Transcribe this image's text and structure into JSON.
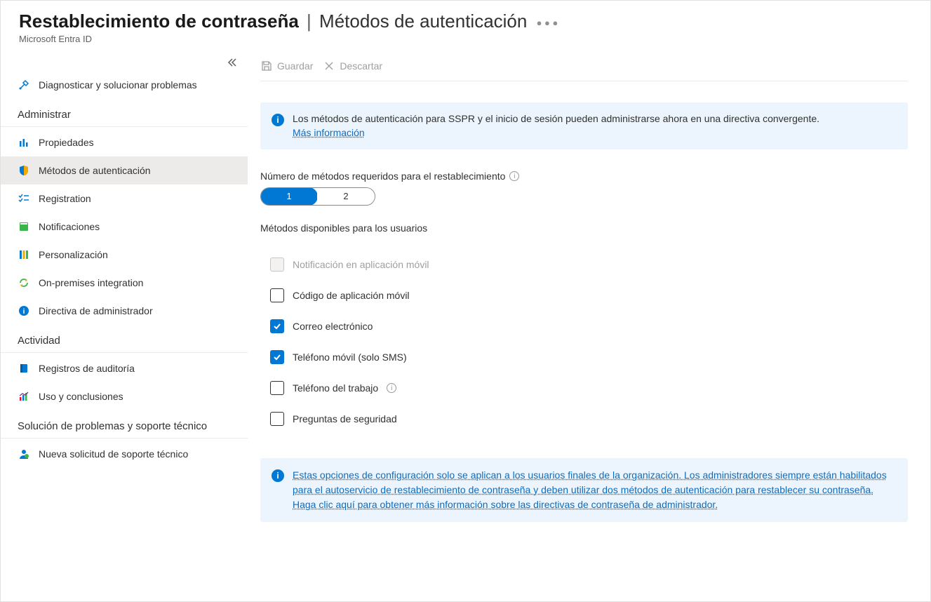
{
  "header": {
    "title_main": "Restablecimiento de contraseña",
    "title_sub": "Métodos de autenticación",
    "subtitle": "Microsoft Entra ID"
  },
  "toolbar": {
    "save_label": "Guardar",
    "discard_label": "Descartar"
  },
  "sidebar": {
    "diagnose": "Diagnosticar y solucionar problemas",
    "section_manage": "Administrar",
    "properties": "Propiedades",
    "auth_methods": "Métodos de autenticación",
    "registration": "Registration",
    "notifications": "Notificaciones",
    "personalization": "Personalización",
    "onprem": "On-premises integration",
    "admin_policy": "Directiva de administrador",
    "section_activity": "Actividad",
    "audit_logs": "Registros de auditoría",
    "usage": "Uso y conclusiones",
    "section_support": "Solución de problemas y soporte técnico",
    "new_request": "Nueva solicitud de soporte técnico"
  },
  "info_banner": {
    "text": "Los métodos de autenticación para SSPR y el inicio de sesión pueden administrarse ahora en una directiva convergente.",
    "link": "Más información"
  },
  "methods_required": {
    "label": "Número de métodos requeridos para el restablecimiento",
    "option1": "1",
    "option2": "2",
    "selected": "1"
  },
  "available_methods": {
    "label": "Métodos disponibles para los usuarios",
    "items": {
      "mobile_app_notification": "Notificación en aplicación móvil",
      "mobile_app_code": "Código de aplicación móvil",
      "email": "Correo electrónico",
      "mobile_phone_sms": "Teléfono móvil (solo SMS)",
      "office_phone": "Teléfono del trabajo",
      "security_questions": "Preguntas de seguridad"
    }
  },
  "bottom_notice": "Estas opciones de configuración solo se aplican a los usuarios finales de la organización. Los administradores siempre están habilitados para el autoservicio de restablecimiento de contraseña y deben utilizar dos métodos de autenticación para restablecer su contraseña. Haga clic aquí para obtener más información sobre las directivas de contraseña de administrador."
}
